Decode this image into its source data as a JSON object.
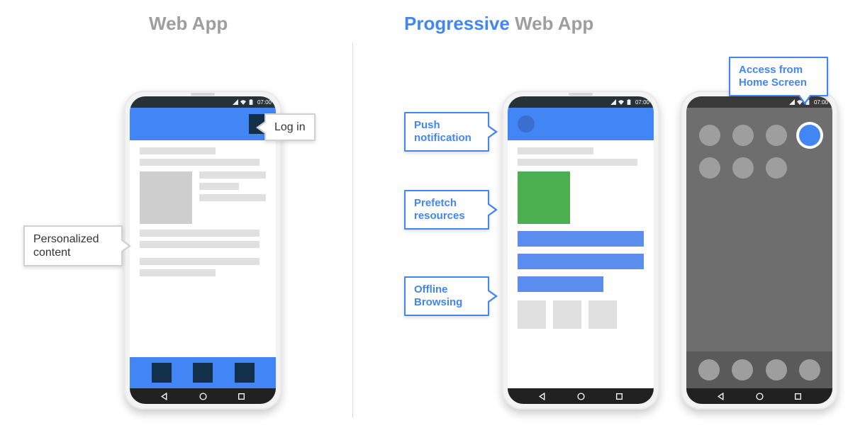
{
  "headings": {
    "left": "Web App",
    "right_accent": "Progressive",
    "right_rest": " Web App"
  },
  "statusbar_time": "07:00",
  "callouts": {
    "login": "Log in",
    "personalized": "Personalized content",
    "push": "Push notification",
    "prefetch": "Prefetch resources",
    "offline": "Offline Browsing",
    "homescreen": "Access from Home Screen"
  }
}
